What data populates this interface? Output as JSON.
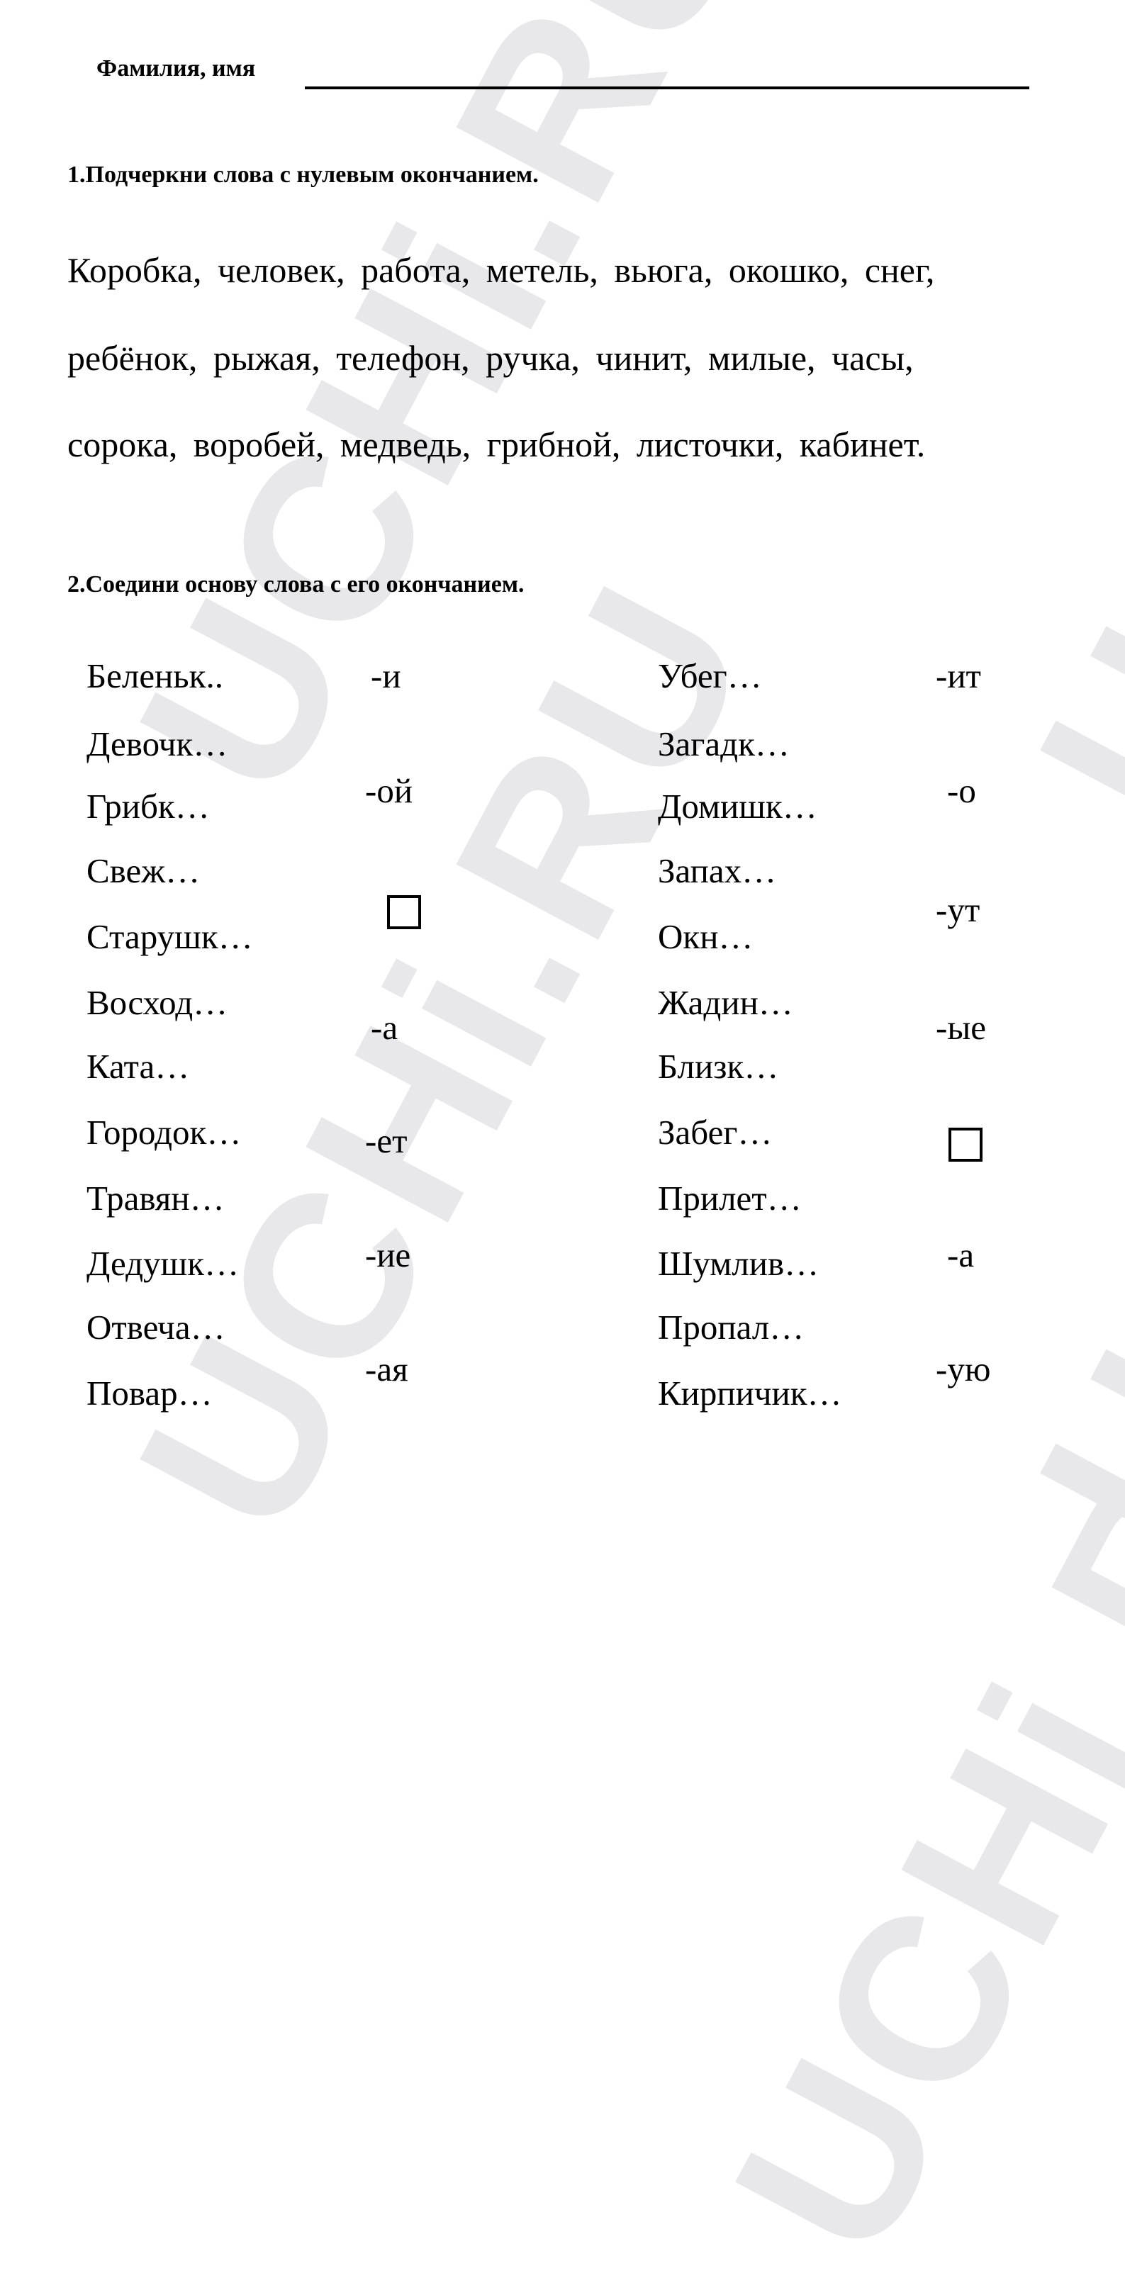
{
  "header": {
    "name_label": "Фамилия, имя"
  },
  "task1": {
    "title": "1.Подчеркни слова с нулевым окончанием.",
    "lines": [
      "Коробка,  человек,  работа,  метель,  вьюга,  окошко,  снег,",
      "ребёнок,  рыжая,  телефон,  ручка,  чинит,  милые,  часы,",
      "сорока,  воробей,  медведь,  грибной,  листочки,  кабинет."
    ]
  },
  "task2": {
    "title": "2.Соедини основу слова с его окончанием.",
    "left_stems": [
      "Беленьк..",
      "Девочк…",
      "Грибк…",
      "Свеж…",
      "Старушк…",
      "Восход…",
      "Ката…",
      "Городок…",
      "Травян…",
      "Дедушк…",
      "Отвеча…",
      "Повар…"
    ],
    "left_endings": [
      "-и",
      "-ой",
      "□",
      "-а",
      "-ет",
      "-ие",
      "-ая"
    ],
    "right_stems": [
      "Убег…",
      "Загадк…",
      "Домишк…",
      "Запах…",
      "Окн…",
      "Жадин…",
      "Близк…",
      "Забег…",
      "Прилет…",
      "Шумлив…",
      "Пропал…",
      "Кирпичик…"
    ],
    "right_endings": [
      "-ит",
      "-о",
      "-ут",
      "-ые",
      "□",
      "-а",
      "-ую"
    ]
  },
  "watermark": {
    "text": "UCHi.RU",
    "color": "#e8e8ea"
  }
}
